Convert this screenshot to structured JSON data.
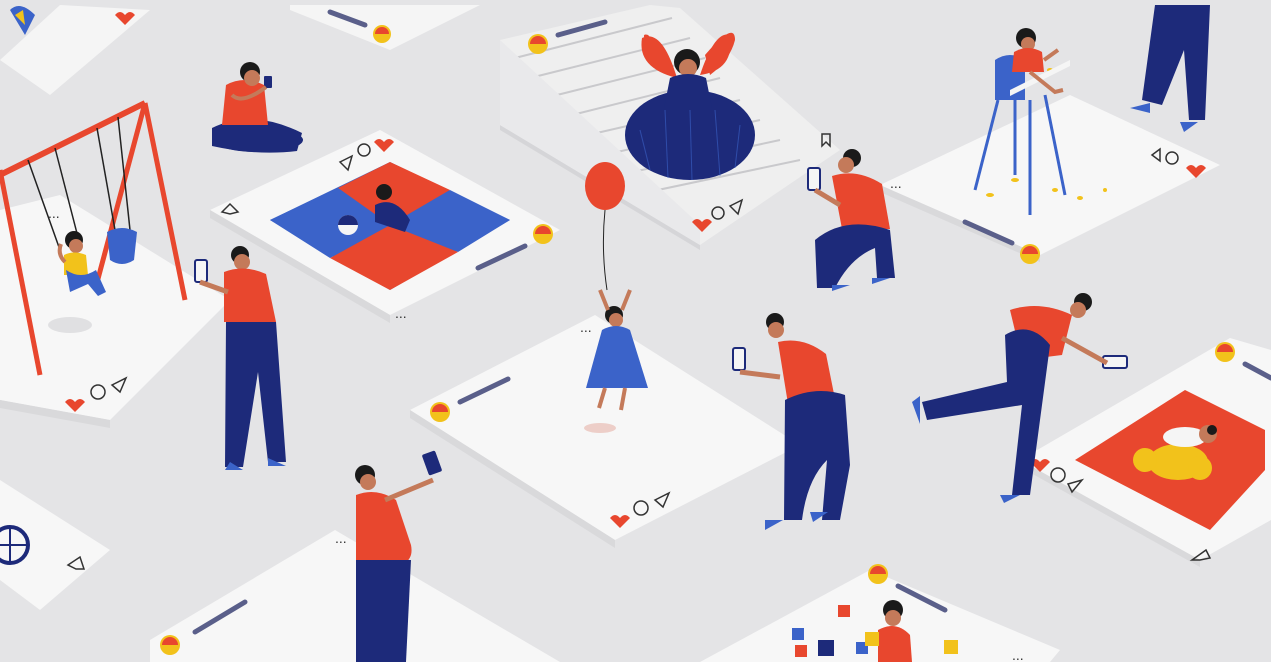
{
  "scene": {
    "background": "#e4e4e6",
    "colors": {
      "orange": "#e8472e",
      "navy": "#1d2a7a",
      "blue": "#3b63c9",
      "skin": "#c47a5a",
      "hair": "#1a1a1a",
      "card": "#f7f7f7",
      "yellow": "#f2c21b",
      "text_bar": "#5a5f8a"
    },
    "subject": "parents photographing children on oversized social media post cards"
  },
  "cards": [
    {
      "id": "swing",
      "icons": [
        "heart-icon",
        "comment-icon",
        "send-icon"
      ]
    },
    {
      "id": "playmat",
      "icons": [
        "heart-icon",
        "share-icon",
        "repost-icon",
        "bookmark-icon"
      ]
    },
    {
      "id": "stairs",
      "icons": [
        "heart-icon",
        "comment-icon",
        "send-icon",
        "bookmark-icon"
      ]
    },
    {
      "id": "highchair",
      "icons": [
        "heart-icon",
        "comment-icon",
        "send-icon"
      ]
    },
    {
      "id": "balloon",
      "icons": [
        "heart-icon",
        "comment-icon",
        "send-icon"
      ]
    },
    {
      "id": "blanket",
      "icons": [
        "heart-icon",
        "comment-icon",
        "send-icon",
        "bookmark-icon"
      ]
    },
    {
      "id": "blocks",
      "icons": []
    },
    {
      "id": "bottom-left",
      "icons": [
        "bookmark-icon"
      ]
    }
  ]
}
